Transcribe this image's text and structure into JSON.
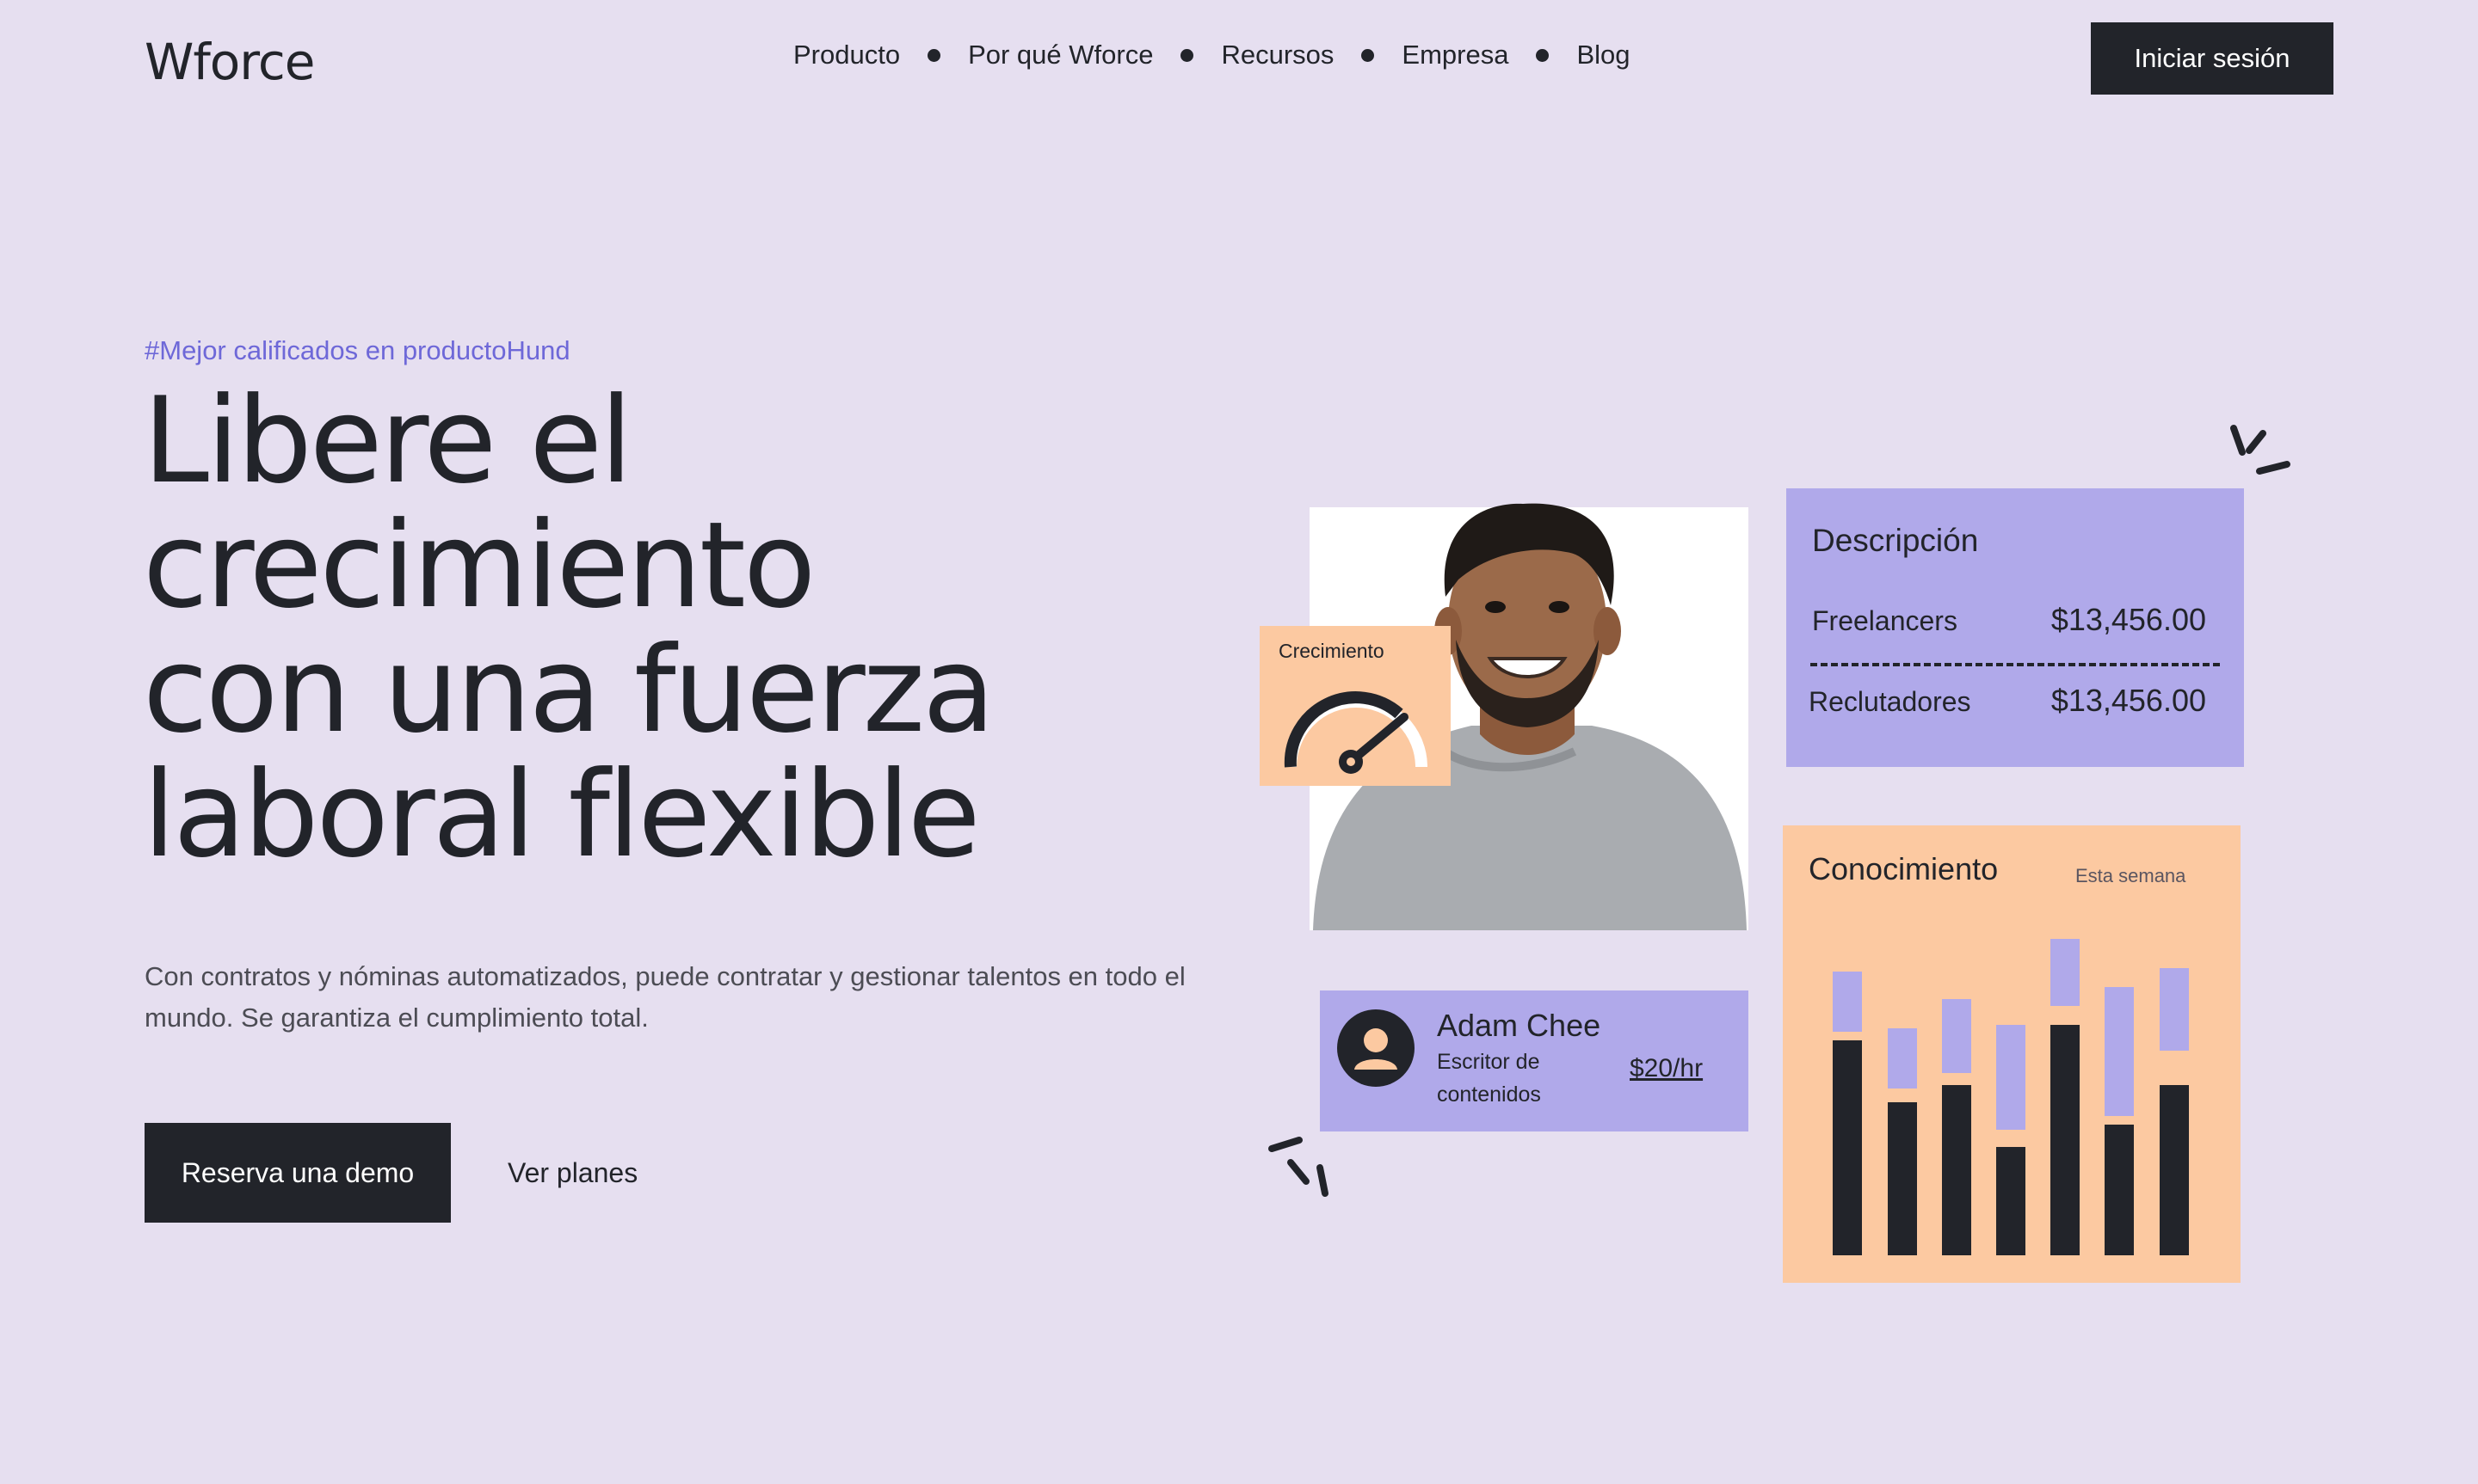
{
  "header": {
    "logo": "Wforce",
    "nav": [
      "Producto",
      "Por qué Wforce",
      "Recursos",
      "Empresa",
      "Blog"
    ],
    "login_label": "Iniciar sesión"
  },
  "hero": {
    "tag": "#Mejor calificados en productoHund",
    "title_lines": [
      "Libere el",
      "crecimiento",
      "con una fuerza",
      "laboral flexible"
    ],
    "subtitle": "Con contratos y nóminas automatizados, puede contratar y gestionar talentos en todo el mundo. Se garantiza el cumplimiento total.",
    "demo_label": "Reserva una demo",
    "plans_label": "Ver planes"
  },
  "growth_card": {
    "label": "Crecimiento"
  },
  "description_card": {
    "title": "Descripción",
    "rows": [
      {
        "label": "Freelancers",
        "value": "$13,456.00"
      },
      {
        "label": "Reclutadores",
        "value": "$13,456.00"
      }
    ]
  },
  "knowledge_card": {
    "title": "Conocimiento",
    "period": "Esta semana"
  },
  "person_card": {
    "name": "Adam Chee",
    "role": "Escritor de contenidos",
    "rate": "$20/hr"
  },
  "colors": {
    "background": "#e6dff0",
    "dark": "#22242a",
    "lavender": "#b0a9ea",
    "peach": "#fcc9a1",
    "accent": "#6e68d8"
  }
}
